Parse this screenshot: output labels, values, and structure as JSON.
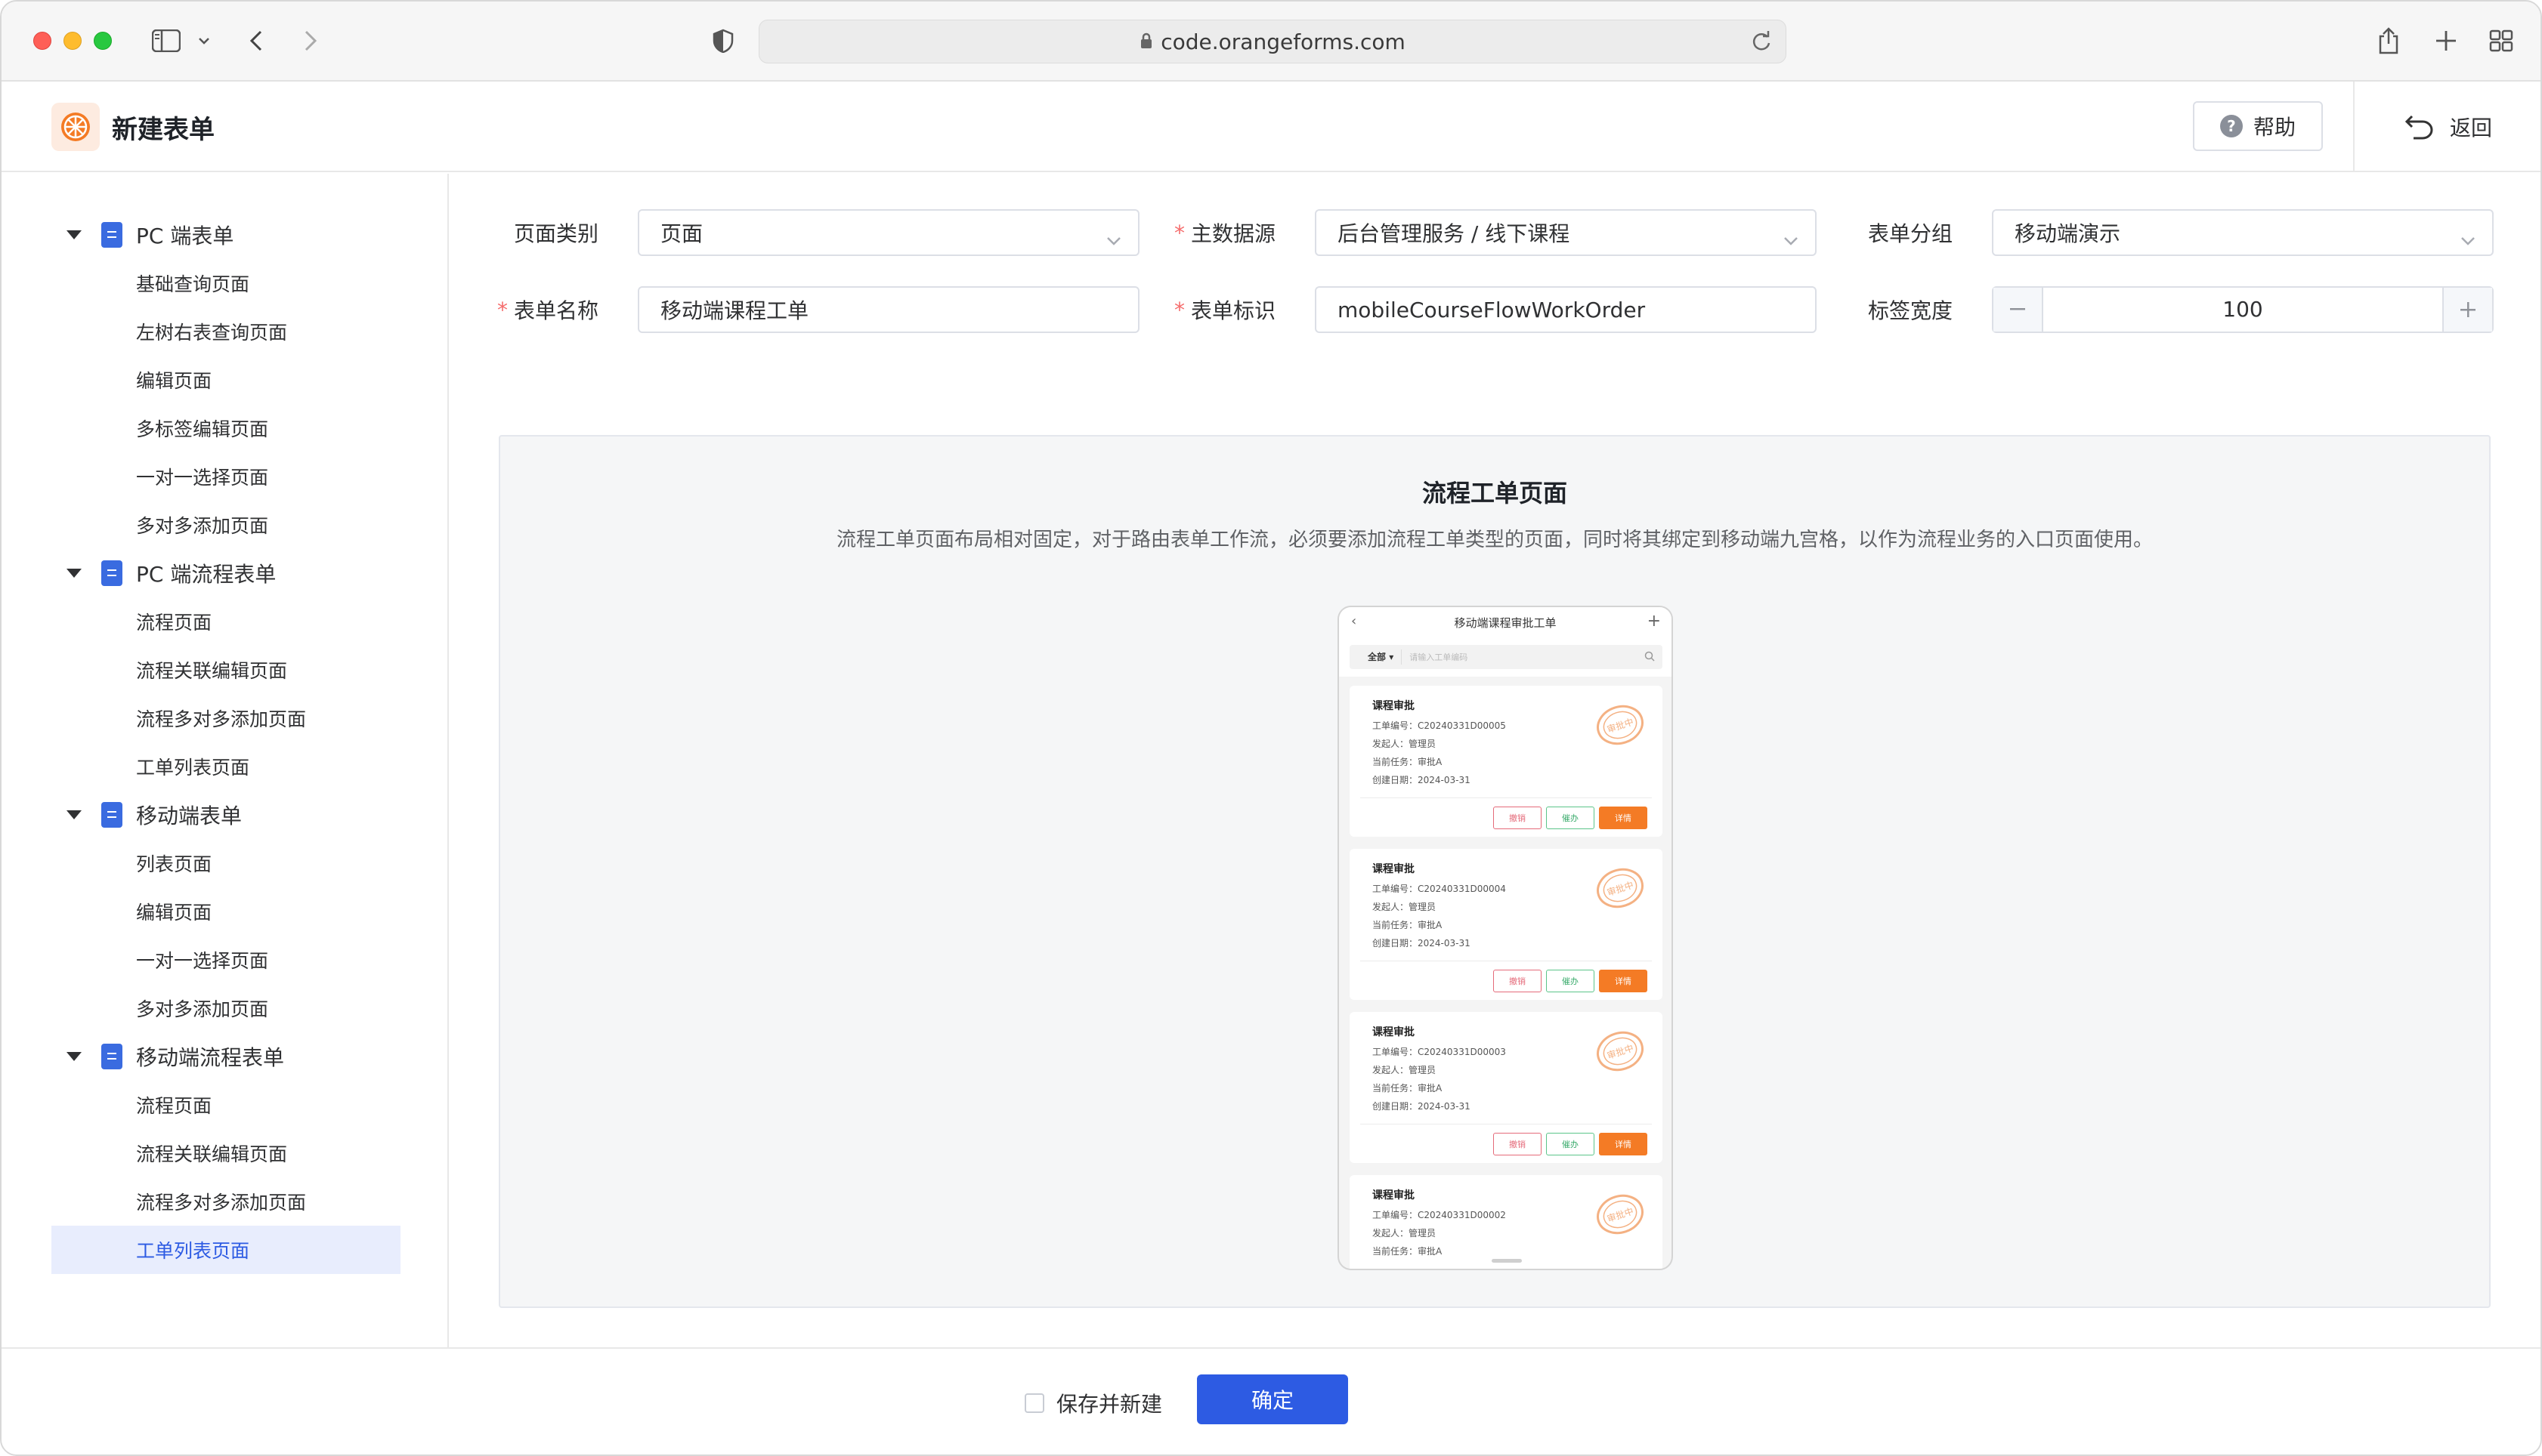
{
  "browser": {
    "url": "code.orangeforms.com"
  },
  "header": {
    "title": "新建表单",
    "help_label": "帮助",
    "back_label": "返回"
  },
  "sidebar": {
    "groups": [
      {
        "label": "PC 端表单",
        "items": [
          "基础查询页面",
          "左树右表查询页面",
          "编辑页面",
          "多标签编辑页面",
          "一对一选择页面",
          "多对多添加页面"
        ]
      },
      {
        "label": "PC 端流程表单",
        "items": [
          "流程页面",
          "流程关联编辑页面",
          "流程多对多添加页面",
          "工单列表页面"
        ]
      },
      {
        "label": "移动端表单",
        "items": [
          "列表页面",
          "编辑页面",
          "一对一选择页面",
          "多对多添加页面"
        ]
      },
      {
        "label": "移动端流程表单",
        "items": [
          "流程页面",
          "流程关联编辑页面",
          "流程多对多添加页面",
          "工单列表页面"
        ]
      }
    ],
    "active": "移动端流程表单/工单列表页面"
  },
  "form": {
    "page_type_label": "页面类别",
    "page_type_value": "页面",
    "datasource_label": "主数据源",
    "datasource_value": "后台管理服务 / 线下课程",
    "group_label": "表单分组",
    "group_value": "移动端演示",
    "name_label": "表单名称",
    "name_value": "移动端课程工单",
    "code_label": "表单标识",
    "code_value": "mobileCourseFlowWorkOrder",
    "label_width_label": "标签宽度",
    "label_width_value": "100",
    "required_mark": "*"
  },
  "preview": {
    "title": "流程工单页面",
    "description": "流程工单页面布局相对固定，对于路由表单工作流，必须要添加流程工单类型的页面，同时将其绑定到移动端九宫格，以作为流程业务的入口页面使用。",
    "phone": {
      "title": "移动端课程审批工单",
      "filter": "全部",
      "search_placeholder": "请输入工单编码",
      "cards": [
        {
          "title": "课程审批",
          "no": "工单编号：C20240331D00005",
          "starter": "发起人：管理员",
          "task": "当前任务：审批A",
          "date": "创建日期：2024-03-31"
        },
        {
          "title": "课程审批",
          "no": "工单编号：C20240331D00004",
          "starter": "发起人：管理员",
          "task": "当前任务：审批A",
          "date": "创建日期：2024-03-31"
        },
        {
          "title": "课程审批",
          "no": "工单编号：C20240331D00003",
          "starter": "发起人：管理员",
          "task": "当前任务：审批A",
          "date": "创建日期：2024-03-31"
        },
        {
          "title": "课程审批",
          "no": "工单编号：C20240331D00002",
          "starter": "发起人：管理员",
          "task": "当前任务：审批A",
          "date": ""
        }
      ],
      "btn_cancel": "撤销",
      "btn_handle": "催办",
      "btn_detail": "详情",
      "stamp_text": "审批中"
    }
  },
  "footer": {
    "save_and_new_label": "保存并新建",
    "confirm_label": "确定"
  },
  "colors": {
    "primary": "#2d5be3",
    "accent_orange": "#f47b25",
    "required": "#f56c6c"
  }
}
